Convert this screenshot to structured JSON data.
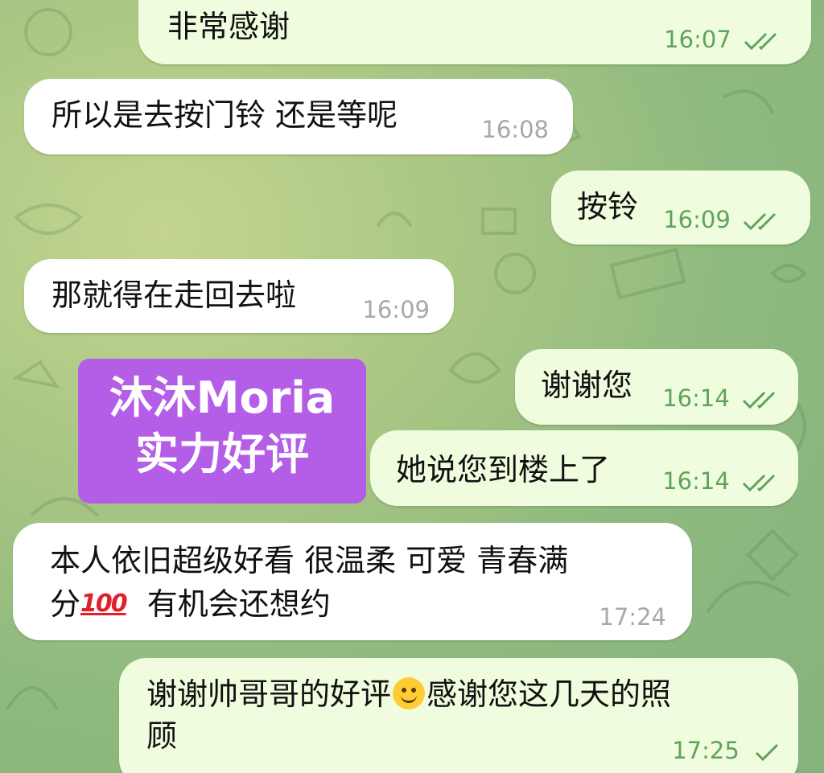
{
  "chat": {
    "messages": [
      {
        "id": "m1",
        "direction": "out",
        "text": "非常感谢",
        "time": "16:07",
        "status": "read"
      },
      {
        "id": "m2",
        "direction": "in",
        "text": "所以是去按门铃 还是等呢",
        "time": "16:08"
      },
      {
        "id": "m3",
        "direction": "out",
        "text": "按铃",
        "time": "16:09",
        "status": "read"
      },
      {
        "id": "m4",
        "direction": "in",
        "text": "那就得在走回去啦",
        "time": "16:09"
      },
      {
        "id": "m5",
        "direction": "out",
        "text": "谢谢您",
        "time": "16:14",
        "status": "read"
      },
      {
        "id": "m6",
        "direction": "out",
        "text": "她说您到楼上了",
        "time": "16:14",
        "status": "read"
      },
      {
        "id": "m7",
        "direction": "in",
        "line1": "本人依旧超级好看 很温柔 可爱 青春满",
        "line2_a": "分",
        "emoji": "💯",
        "line2_b": "有机会还想约",
        "time": "17:24"
      },
      {
        "id": "m8",
        "direction": "out",
        "line1_a": "谢谢帅哥哥的好评",
        "emoji": "😊",
        "line1_b": "感谢您这几天的照",
        "line2": "顾",
        "time": "17:25",
        "status": "sent"
      }
    ]
  },
  "sticker": {
    "line1": "沐沐Moria",
    "line2": "实力好评",
    "color": "#b45ee8"
  },
  "colors": {
    "incoming_bubble": "#ffffff",
    "outgoing_bubble": "#effdde",
    "outgoing_time": "#5fa35a",
    "incoming_time": "#a3a9ad",
    "background": "#a7c583"
  },
  "icons": {
    "read_receipt": "double-check-icon",
    "sent_receipt": "single-check-icon"
  }
}
